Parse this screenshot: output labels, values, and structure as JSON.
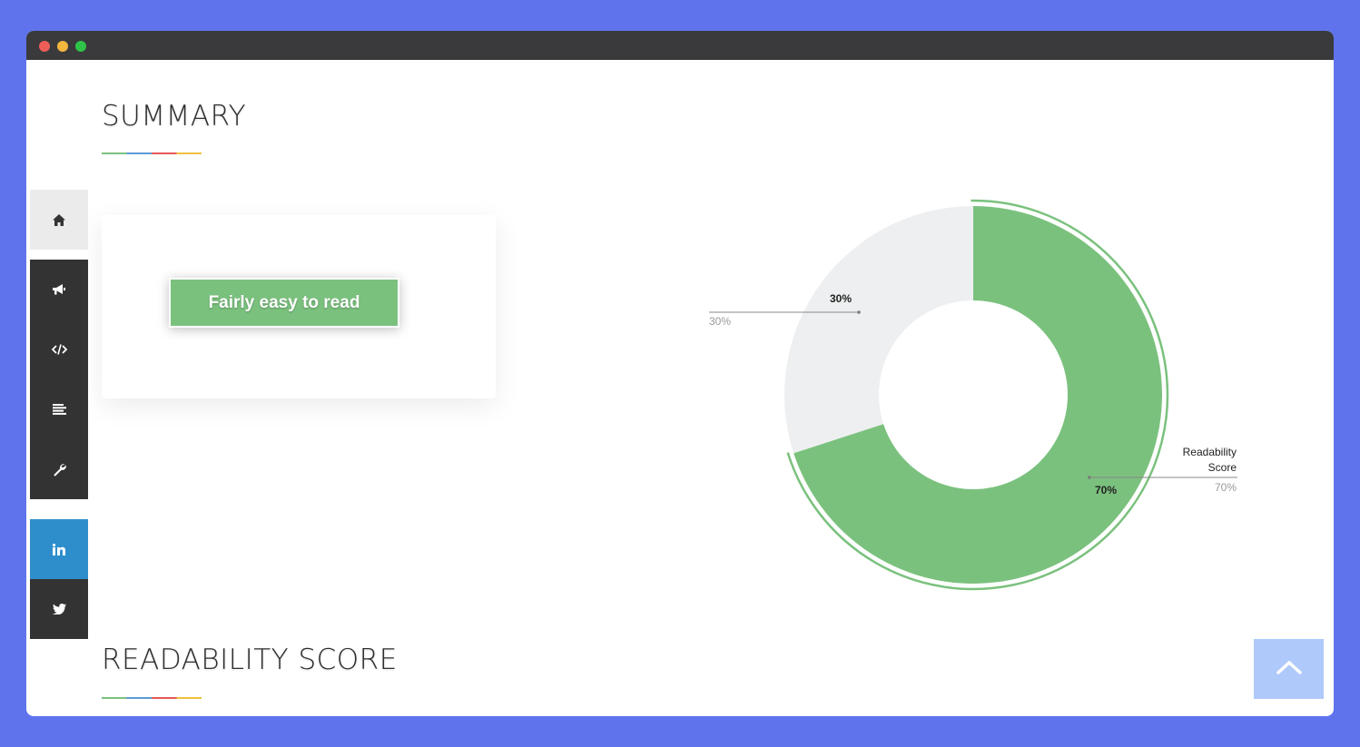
{
  "sections": {
    "summary_title": "SUMMARY",
    "readability_title": "READABILITY SCORE"
  },
  "summary_card": {
    "badge_label": "Fairly easy to read",
    "badge_color": "#7bc17e"
  },
  "sidebar": {
    "items": [
      {
        "icon": "home-icon",
        "bg": "#ebebeb",
        "fg": "#333333"
      },
      {
        "icon": "megaphone-icon",
        "bg": "#333333",
        "fg": "#ffffff"
      },
      {
        "icon": "code-icon",
        "bg": "#333333",
        "fg": "#ffffff"
      },
      {
        "icon": "text-align-icon",
        "bg": "#333333",
        "fg": "#ffffff"
      },
      {
        "icon": "wrench-icon",
        "bg": "#333333",
        "fg": "#ffffff"
      },
      {
        "icon": "linkedin-icon",
        "bg": "#2e8ecc",
        "fg": "#ffffff"
      },
      {
        "icon": "twitter-icon",
        "bg": "#333333",
        "fg": "#ffffff"
      }
    ]
  },
  "chart_data": {
    "type": "pie",
    "variant": "donut",
    "slices": [
      {
        "label": "Readability Score",
        "value": 70,
        "inner_label": "70%",
        "outer_value_label": "70%",
        "color": "#7bc17e"
      },
      {
        "label": "",
        "value": 30,
        "inner_label": "30%",
        "outer_value_label": "30%",
        "color": "#eeeff0"
      }
    ]
  },
  "scroll_top": {
    "icon": "chevron-up-icon",
    "color": "#b0c9fb"
  }
}
